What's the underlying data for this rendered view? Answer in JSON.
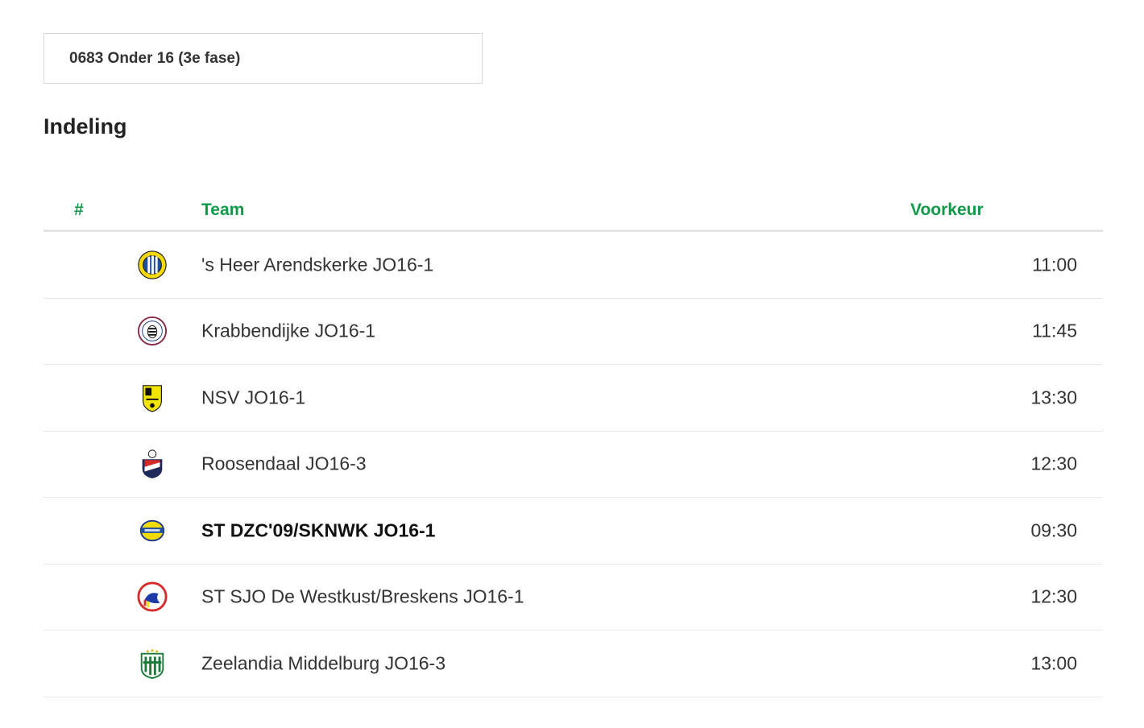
{
  "competition": {
    "label": "0683 Onder 16 (3e fase)"
  },
  "section": {
    "title": "Indeling"
  },
  "table": {
    "headers": {
      "number": "#",
      "team": "Team",
      "preference": "Voorkeur"
    },
    "rows": [
      {
        "team": "'s Heer Arendskerke JO16-1",
        "preference": "11:00",
        "logo": "club-crest-heer-arendskerke-icon"
      },
      {
        "team": "Krabbendijke JO16-1",
        "preference": "11:45",
        "logo": "club-crest-krabbendijke-icon"
      },
      {
        "team": "NSV JO16-1",
        "preference": "13:30",
        "logo": "club-crest-nsv-icon"
      },
      {
        "team": "Roosendaal JO16-3",
        "preference": "12:30",
        "logo": "club-crest-roosendaal-icon"
      },
      {
        "team": "ST DZC'09/SKNWK JO16-1",
        "preference": "09:30",
        "logo": "club-crest-dzc-icon",
        "highlight": true
      },
      {
        "team": "ST SJO De Westkust/Breskens JO16-1",
        "preference": "12:30",
        "logo": "club-crest-westkust-icon"
      },
      {
        "team": "Zeelandia Middelburg JO16-3",
        "preference": "13:00",
        "logo": "club-crest-zeelandia-icon"
      }
    ]
  },
  "colors": {
    "accent": "#0f9a4a",
    "divider": "#e4e4e4",
    "text": "#333333"
  }
}
